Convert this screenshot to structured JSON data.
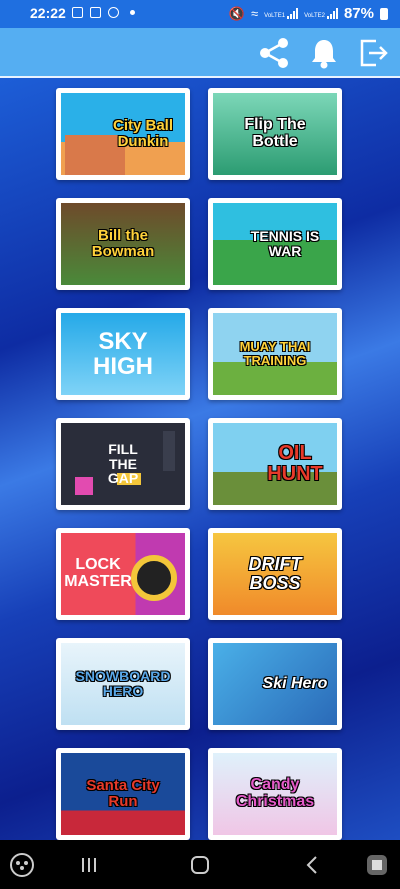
{
  "status_bar": {
    "time": "22:22",
    "net1": "VoLTE1",
    "net2": "VoLTE2",
    "battery": "87%"
  },
  "app_bar": {
    "icons": [
      "share-icon",
      "bell-icon",
      "exit-icon"
    ]
  },
  "games": [
    {
      "title": "City Ball Dunkin",
      "colors": [
        "#2ab0e8",
        "#f0a050"
      ]
    },
    {
      "title": "Flip The Bottle",
      "colors": [
        "#7cd7b8",
        "#2c9c72"
      ]
    },
    {
      "title": "Bill the Bowman",
      "colors": [
        "#4a8a3a",
        "#6e4a2a"
      ]
    },
    {
      "title": "TENNIS IS WAR",
      "colors": [
        "#2fbfe0",
        "#3aa54a"
      ]
    },
    {
      "title": "SKY HIGH",
      "colors": [
        "#25a9e8",
        "#7fd3f7"
      ]
    },
    {
      "title": "MUAY THAI TRAINING",
      "colors": [
        "#8fd3f0",
        "#6cb040"
      ]
    },
    {
      "title": "FILL THE GAP",
      "colors": [
        "#2a2d3a",
        "#3a3e4d"
      ]
    },
    {
      "title": "OIL HUNT",
      "colors": [
        "#7fd0f0",
        "#6a8f3a"
      ]
    },
    {
      "title": "LOCK MASTER",
      "colors": [
        "#ef4a5a",
        "#c03ab0"
      ]
    },
    {
      "title": "DRIFT BOSS",
      "colors": [
        "#f6c640",
        "#f08a2a"
      ]
    },
    {
      "title": "SNOWBOARD HERO",
      "colors": [
        "#e8f4fb",
        "#bfe0f2"
      ]
    },
    {
      "title": "Ski Hero",
      "colors": [
        "#4ab0e8",
        "#2a6ab8"
      ]
    },
    {
      "title": "Santa City Run",
      "colors": [
        "#1a4a9a",
        "#c8283a"
      ]
    },
    {
      "title": "Candy Christmas",
      "colors": [
        "#dff1fb",
        "#f0c6e6"
      ]
    }
  ],
  "nav_bar": {
    "icons": [
      "game-controller-icon",
      "recent-apps-icon",
      "home-icon",
      "back-icon",
      "assistant-icon"
    ]
  }
}
